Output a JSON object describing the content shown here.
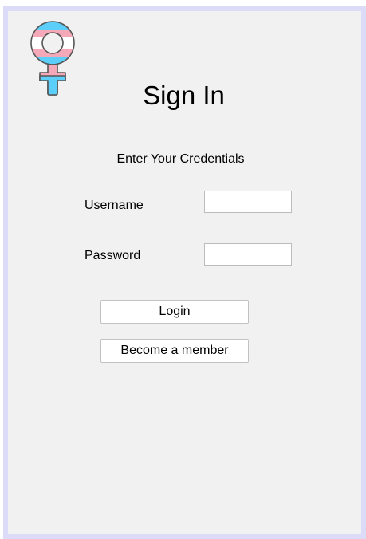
{
  "window": {
    "title": "Sign In",
    "subtitle": "Enter Your Credentials",
    "logo_icon": "venus-symbol-icon",
    "logo_colors": [
      "#5bcefa",
      "#f5a9b8",
      "#ffffff"
    ]
  },
  "form": {
    "username_label": "Username",
    "username_value": "",
    "password_label": "Password",
    "password_value": ""
  },
  "buttons": {
    "login_label": "Login",
    "become_member_label": "Become a member"
  }
}
